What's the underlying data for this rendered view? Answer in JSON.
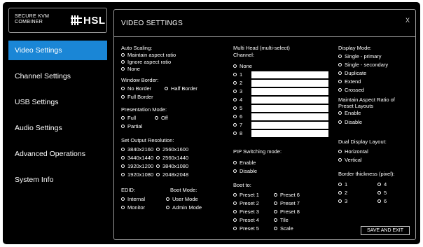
{
  "logo": {
    "line1": "SECURE KVM",
    "line2": "COMBINER",
    "brand": "HSL",
    "icon": "hsl-logo-icon"
  },
  "nav": [
    {
      "label": "Video Settings",
      "active": true
    },
    {
      "label": "Channel Settings"
    },
    {
      "label": "USB Settings"
    },
    {
      "label": "Audio Settings"
    },
    {
      "label": "Advanced Operations"
    },
    {
      "label": "System Info"
    }
  ],
  "panel": {
    "title": "VIDEO SETTINGS",
    "close": "X"
  },
  "auto_scaling": {
    "label": "Auto Scaling:",
    "options": [
      "Maintain aspect ratio",
      "Ignore aspect ratio",
      "None"
    ]
  },
  "window_border": {
    "label": "Window Border:",
    "options": [
      "No Border",
      "Half Border",
      "Full Border"
    ]
  },
  "presentation_mode": {
    "label": "Presentation Mode:",
    "options": [
      "Full",
      "Off",
      "Partial"
    ]
  },
  "output_resolution": {
    "label": "Set Output Resolution:",
    "options": [
      "3840x2160",
      "2560x1600",
      "3440x1440",
      "2560x1440",
      "1920x1200",
      "3840x1080",
      "1920x1080",
      "2048x2048"
    ]
  },
  "edid": {
    "label": "EDID:",
    "options": [
      "Internal",
      "Monitor"
    ]
  },
  "boot_mode": {
    "label": "Boot Mode:",
    "options": [
      "User Mode",
      "Admin Mode"
    ]
  },
  "multi_head": {
    "label": "Multi Head (multi-select)",
    "sublabel": "Channel:",
    "none": "None",
    "channels": [
      "1",
      "2",
      "3",
      "4",
      "5",
      "6",
      "7",
      "8"
    ]
  },
  "pip_switching": {
    "label": "PIP Switching mode:",
    "options": [
      "Enable",
      "Disable"
    ]
  },
  "boot_to": {
    "label": "Boot to:",
    "options": [
      "Preset 1",
      "Preset 6",
      "Preset 2",
      "Preset 7",
      "Preset 3",
      "Preset 8",
      "Preset 4",
      "Tile",
      "Preset 5",
      "Scale"
    ]
  },
  "display_mode": {
    "label": "Display Mode:",
    "options": [
      "Single - primary",
      "Single - secondary",
      "Duplicate",
      "Extend",
      "Crossed"
    ]
  },
  "aspect_ratio_presets": {
    "label_line1": "Maintain Aspect Ratio of",
    "label_line2": "Preset Layouts",
    "options": [
      "Enable",
      "Disable"
    ]
  },
  "dual_display_layout": {
    "label": "Dual Display Layout:",
    "options": [
      "Horizontal",
      "Vertical"
    ]
  },
  "border_thickness": {
    "label": "Border thickness (pixel):",
    "options": [
      "1",
      "4",
      "2",
      "5",
      "3",
      "6"
    ]
  },
  "save_button": "SAVE AND EXIT",
  "colors": {
    "background": "#000000",
    "accent": "#1a86d6",
    "border": "#9a9a9a",
    "text": "#ffffff"
  }
}
